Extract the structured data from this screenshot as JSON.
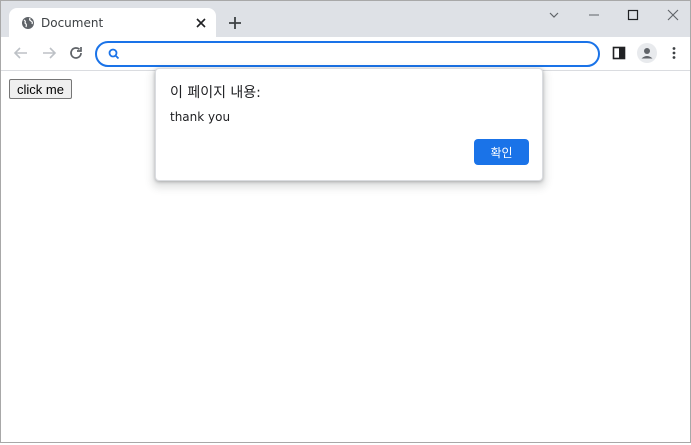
{
  "tab": {
    "title": "Document"
  },
  "omnibox": {
    "value": "",
    "placeholder": ""
  },
  "page": {
    "button_label": "click me"
  },
  "alert": {
    "heading": "이 페이지 내용:",
    "message": "thank you",
    "ok_label": "확인"
  },
  "colors": {
    "accent": "#1a73e8",
    "tabstrip": "#dee1e6"
  },
  "icons": {
    "favicon": "globe-icon",
    "tab_close": "close-icon",
    "new_tab": "plus-icon",
    "back": "arrow-left-icon",
    "forward": "arrow-right-icon",
    "reload": "reload-icon",
    "search": "search-icon",
    "side_panel": "side-panel-icon",
    "profile": "profile-icon",
    "menu": "kebab-menu-icon",
    "tab_search": "chevron-down-icon",
    "minimize": "minimize-icon",
    "maximize": "maximize-icon",
    "close_window": "close-window-icon"
  }
}
